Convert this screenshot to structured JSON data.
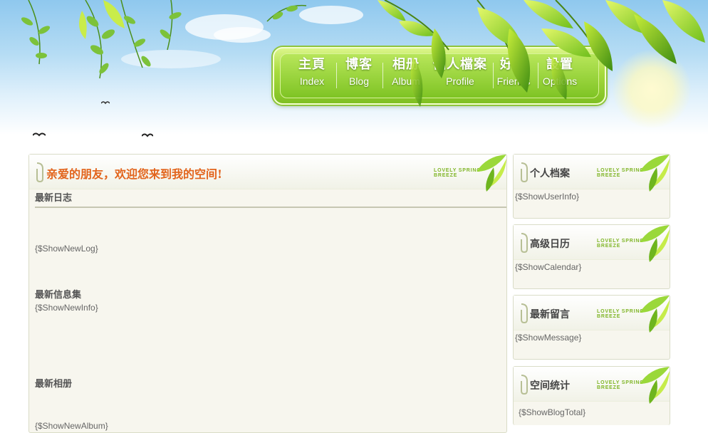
{
  "nav": {
    "items": [
      {
        "cn": "主頁",
        "en": "Index"
      },
      {
        "cn": "博客",
        "en": "Blog"
      },
      {
        "cn": "相册",
        "en": "Album"
      },
      {
        "cn": "個人檔案",
        "en": "Profile"
      },
      {
        "cn": "好友",
        "en": "Friends"
      },
      {
        "cn": "設置",
        "en": "Options"
      }
    ]
  },
  "main": {
    "welcome": "亲爱的朋友，欢迎您来到我的空间!",
    "badge": "LOVELY SPRING BREEZE",
    "sections": {
      "newlog_title": "最新日志",
      "newlog_value": "{$ShowNewLog}",
      "newinfo_title": "最新信息集",
      "newinfo_value": "{$ShowNewInfo}",
      "album_title": "最新相册",
      "album_value": "{$ShowNewAlbum}"
    }
  },
  "sidebar": {
    "badge": "LOVELY SPRING BREEZE",
    "panels": [
      {
        "title": "个人档案",
        "value": "{$ShowUserInfo}"
      },
      {
        "title": "高级日历",
        "value": "{$ShowCalendar}"
      },
      {
        "title": "最新留言",
        "value": "{$ShowMessage}"
      },
      {
        "title": "空间统计",
        "value": "{$ShowBlogTotal}"
      }
    ]
  },
  "colors": {
    "accent_orange": "#e2641c",
    "leaf_green": "#8cc63f",
    "panel_bg": "#f7f6ee"
  },
  "icons": [
    "leaf-vine-icon",
    "bird-icon",
    "paperclip-icon",
    "leaf-corner-icon"
  ]
}
